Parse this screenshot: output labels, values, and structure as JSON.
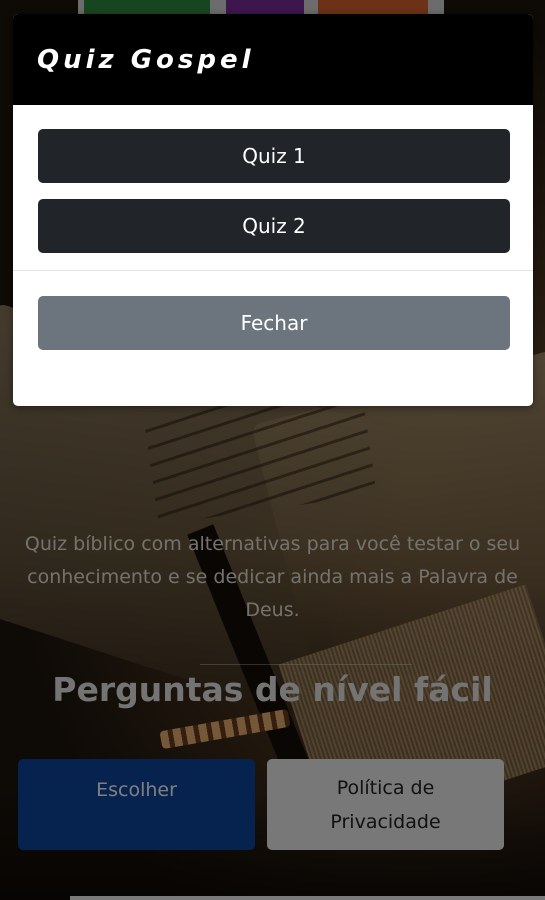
{
  "modal": {
    "title": "Quiz Gospel",
    "quiz_buttons": [
      "Quiz 1",
      "Quiz 2"
    ],
    "close_label": "Fechar"
  },
  "page": {
    "description": "Quiz bíblico com alternativas para você testar o seu conhecimento e se dedicar ainda mais a Palavra de Deus.",
    "level_heading": "Perguntas de nível fácil",
    "choose_label": "Escolher",
    "privacy_label": "Política de Privacidade"
  },
  "colors": {
    "choose_button": "#0d47a1",
    "quiz_button": "#212529",
    "close_button": "#6c757d",
    "modal_header": "#000000"
  }
}
